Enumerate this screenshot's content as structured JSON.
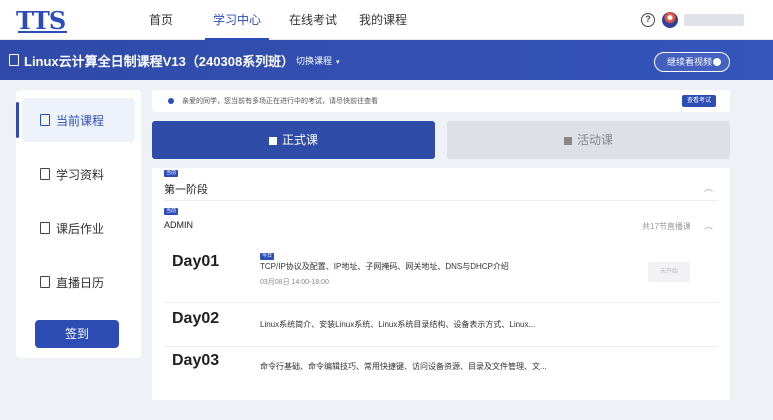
{
  "topnav": {
    "logo": "TTS",
    "items": [
      {
        "label": "首页"
      },
      {
        "label": "学习中心"
      },
      {
        "label": "在线考试"
      },
      {
        "label": "我的课程"
      }
    ],
    "help_symbol": "?"
  },
  "banner": {
    "course_title": "Linux云计算全日制课程V13（240308系列班）",
    "switch_label": "切换课程",
    "switch_caret": "▾",
    "watch_label": "继续看视频"
  },
  "sidebar": {
    "items": [
      {
        "label": "当前课程",
        "icon": "book-icon"
      },
      {
        "label": "学习资料",
        "icon": "document-icon"
      },
      {
        "label": "课后作业",
        "icon": "edit-icon"
      },
      {
        "label": "直播日历",
        "icon": "calendar-icon"
      }
    ],
    "sign_button": "签到"
  },
  "notice": {
    "text": "亲爱的同学，您当前有多场正在进行中的考试，请尽快前往查看",
    "button": "查看考试"
  },
  "tabs": {
    "formal": "正式课",
    "activity": "活动课"
  },
  "schedule": {
    "stage_tag": "当前",
    "stage_title": "第一阶段",
    "module_tag": "当前",
    "module_title": "ADMIN",
    "lesson_count": "共17节直播课",
    "chevron_up": "︿",
    "days": [
      {
        "day": "Day01",
        "tag": "今日",
        "topic": "TCP/IP协议及配置、IP地址、子网掩码、网关地址、DNS与DHCP介绍",
        "time": "03月08日 14:00-18:00",
        "status": "未开始"
      },
      {
        "day": "Day02",
        "topic": "Linux系统简介、安装Linux系统、Linux系统目录结构、设备表示方式、Linux..."
      },
      {
        "day": "Day03",
        "topic": "命令行基础、命令编辑技巧、常用快捷键、访问设备资源、目录及文件管理、文..."
      }
    ]
  },
  "colors": {
    "primary": "#2c4db8",
    "banner": "#3050b0",
    "page_bg": "#eef1f6"
  }
}
